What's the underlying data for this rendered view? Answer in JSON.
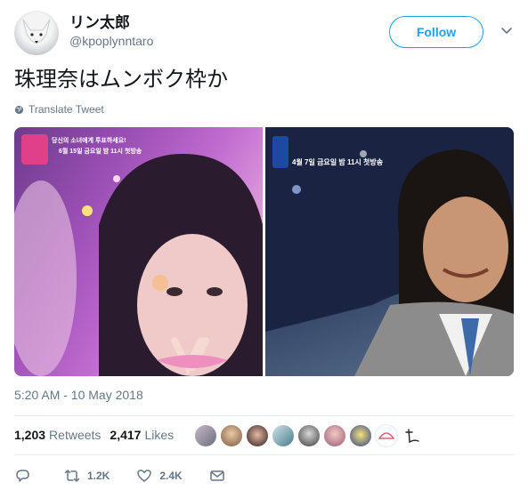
{
  "user": {
    "display_name": "リン太郎",
    "handle": "@kpoplynntaro"
  },
  "follow_button": {
    "label": "Follow"
  },
  "tweet": {
    "text": "珠理奈はムンボク枠か",
    "translate_label": "Translate Tweet",
    "timestamp": "5:20 AM - 10 May 2018"
  },
  "media": {
    "left_banner_line1": "당신의 소녀에게 투표하세요!",
    "left_banner_line2": "6월 15일 금요일 밤 11시 첫방송",
    "right_banner": "4월 7일 금요일 밤 11시 첫방송"
  },
  "stats": {
    "retweets_count": "1,203",
    "retweets_label": "Retweets",
    "likes_count": "2,417",
    "likes_label": "Likes"
  },
  "actions": {
    "reply_count": "",
    "retweet_count": "1.2K",
    "like_count": "2.4K"
  },
  "colors": {
    "accent": "#1da1f2",
    "secondary_text": "#657786",
    "primary_text": "#14171a",
    "divider": "#e6ecf0"
  },
  "icons": {
    "caret": "chevron-down-icon",
    "translate": "globe-icon",
    "reply": "reply-icon",
    "retweet": "retweet-icon",
    "like": "heart-icon",
    "dm": "envelope-icon"
  }
}
